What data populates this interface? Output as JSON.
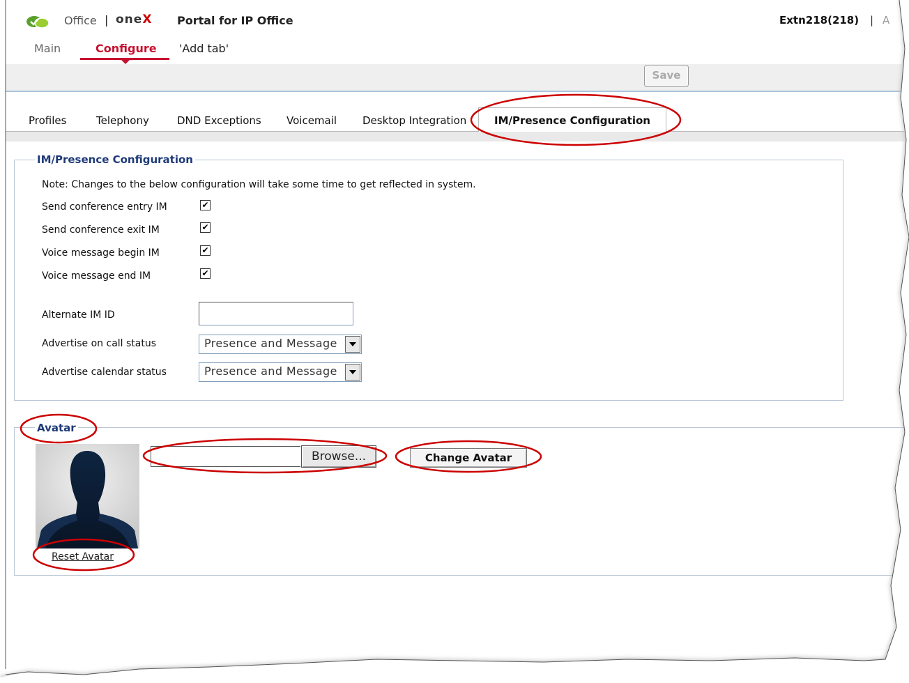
{
  "header": {
    "app_name": "Office",
    "brand_separator": "|",
    "brand_onex_prefix": "one",
    "brand_onex_suffix": "X",
    "brand_portal": "Portal for IP Office",
    "user": "Extn218(218)",
    "user_separator": "|",
    "user_cut_text": "A"
  },
  "nav": {
    "main": "Main",
    "configure": "Configure",
    "add_tab": "'Add tab'"
  },
  "toolbar": {
    "save_label": "Save"
  },
  "subtabs": {
    "profiles": "Profiles",
    "telephony": "Telephony",
    "dnd_exceptions": "DND Exceptions",
    "voicemail": "Voicemail",
    "desktop_integration": "Desktop Integration",
    "im_presence": "IM/Presence Configuration"
  },
  "im_config": {
    "legend": "IM/Presence Configuration",
    "note": "Note: Changes to the below configuration will take some time to get reflected in system.",
    "checkboxes": [
      {
        "label": "Send conference entry IM",
        "checked": true
      },
      {
        "label": "Send conference exit IM",
        "checked": true
      },
      {
        "label": "Voice message begin IM",
        "checked": true
      },
      {
        "label": "Voice message end IM",
        "checked": true
      }
    ],
    "alternate_im_id_label": "Alternate IM ID",
    "alternate_im_id_value": "",
    "advertise_on_call_label": "Advertise on call status",
    "advertise_on_call_value": "Presence and Message",
    "advertise_calendar_label": "Advertise calendar status",
    "advertise_calendar_value": "Presence and Message"
  },
  "avatar": {
    "legend": "Avatar",
    "reset_label": "Reset Avatar",
    "file_value": "",
    "browse_label": "Browse...",
    "change_label": "Change Avatar"
  },
  "colors": {
    "accent_red": "#c8102e",
    "legend_blue": "#1e3a78",
    "annotation_red": "#cc0000"
  }
}
